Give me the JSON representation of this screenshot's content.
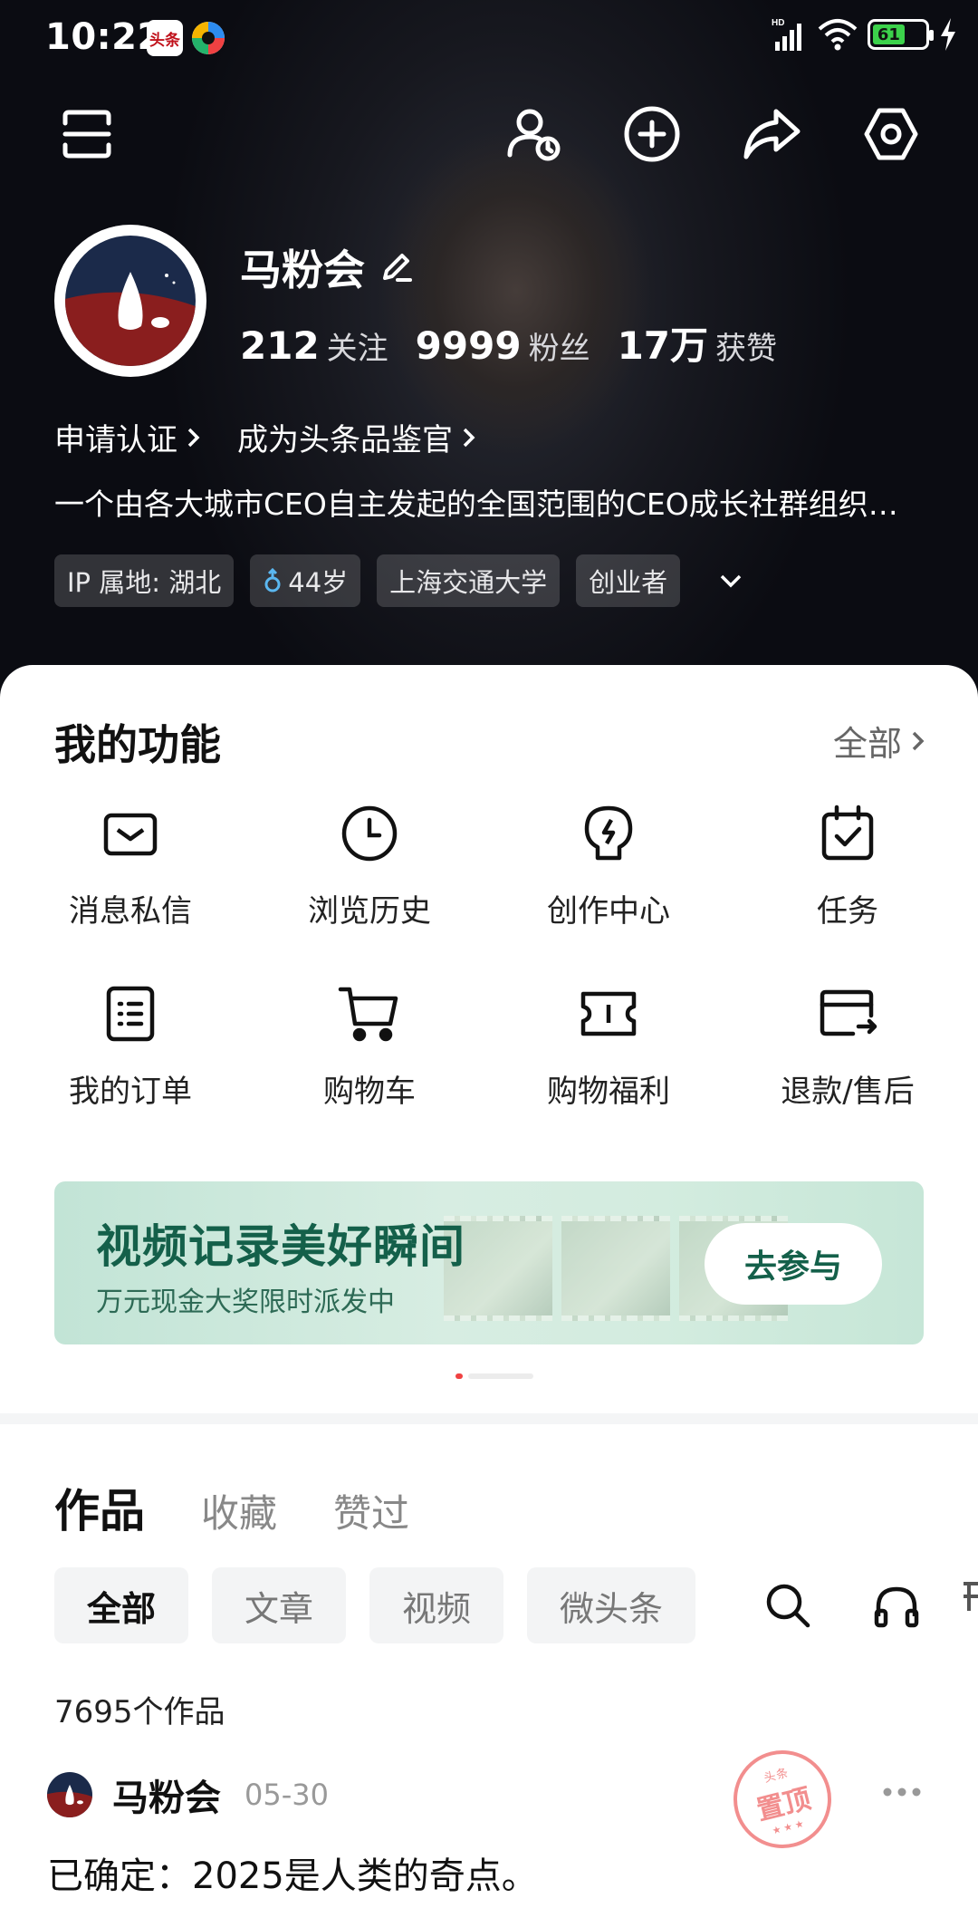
{
  "status_bar": {
    "time": "10:22",
    "app_badge": "头条",
    "battery_level": "61"
  },
  "profile": {
    "name": "马粉会",
    "stats": [
      {
        "value": "212",
        "label": "关注"
      },
      {
        "value": "9999",
        "label": "粉丝"
      },
      {
        "value": "17万",
        "label": "获赞"
      }
    ],
    "links": [
      "申请认证",
      "成为头条品鉴官"
    ],
    "bio": "一个由各大城市CEO自主发起的全国范围的CEO成长社群组织，致力于打造全国最具影响力的CEO成长社群",
    "tags": {
      "location": "IP 属地: 湖北",
      "age": "44岁",
      "school": "上海交通大学",
      "occupation": "创业者"
    }
  },
  "functions": {
    "title": "我的功能",
    "see_all": "全部",
    "items": [
      {
        "label": "消息私信",
        "icon": "message-icon"
      },
      {
        "label": "浏览历史",
        "icon": "clock-icon"
      },
      {
        "label": "创作中心",
        "icon": "bulb-icon"
      },
      {
        "label": "任务",
        "icon": "calendar-check-icon"
      },
      {
        "label": "我的订单",
        "icon": "order-list-icon"
      },
      {
        "label": "购物车",
        "icon": "cart-icon"
      },
      {
        "label": "购物福利",
        "icon": "coupon-icon"
      },
      {
        "label": "退款/售后",
        "icon": "refund-card-icon"
      }
    ]
  },
  "banner": {
    "title": "视频记录美好瞬间",
    "subtitle": "万元现金大奖限时派发中",
    "button": "去参与"
  },
  "works": {
    "tabs": [
      "作品",
      "收藏",
      "赞过"
    ],
    "filters": [
      "全部",
      "文章",
      "视频",
      "微头条"
    ],
    "count": "7695个作品",
    "post": {
      "author": "马粉会",
      "date": "05-30",
      "pin_label": "置顶",
      "pin_small": "头条",
      "text": "已确定：2025是人类的奇点。"
    }
  },
  "colors": {
    "accent_red": "#f04142",
    "banner_green": "#14604a",
    "battery_green": "#3cd24b"
  }
}
